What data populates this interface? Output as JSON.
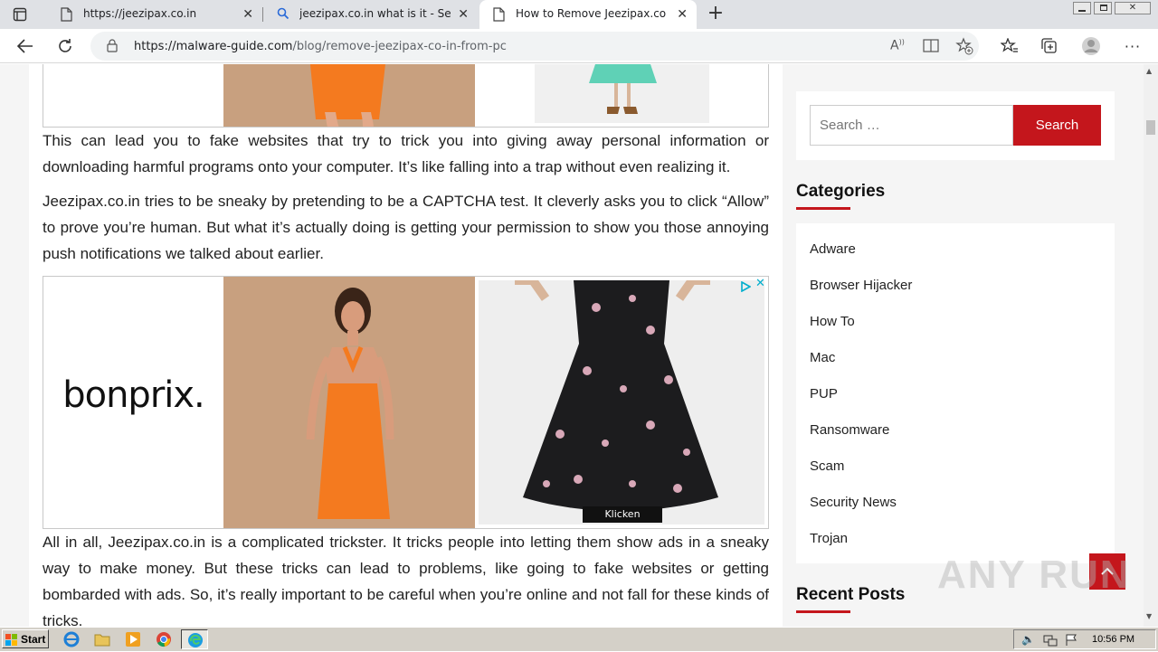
{
  "browser": {
    "tabs": [
      {
        "title": "https://jeezipax.co.in",
        "icon": "page-icon"
      },
      {
        "title": "jeezipax.co.in what is it - Search",
        "icon": "search-icon"
      },
      {
        "title": "How to Remove Jeezipax.co.in f",
        "icon": "page-icon",
        "active": true
      }
    ],
    "new_tab_label": "+",
    "url_domain": "https://malware-guide.com",
    "url_path": "/blog/remove-jeezipax-co-in-from-pc"
  },
  "article": {
    "para1": "This can lead you to fake websites that try to trick you into giving away personal information or downloading harmful programs onto your computer. It’s like falling into a trap without even realizing it.",
    "para2": "Jeezipax.co.in tries to be sneaky by pretending to be a CAPTCHA test. It cleverly asks you to click “Allow” to prove you’re human. But what it’s actually doing is getting your permission to show you those annoying push notifications we talked about earlier.",
    "para3": "All in all, Jeezipax.co.in is a complicated trickster. It tricks people into letting them show ads in a sneaky way to make money. But these tricks can lead to problems, like going to fake websites or getting bombarded with ads. So, it’s really important to be careful when you’re online and not fall for these kinds of tricks."
  },
  "ad": {
    "brand": "bonprix.",
    "cta": "Klicken",
    "choices_icon": "adchoices-icon",
    "close_icon": "close-icon"
  },
  "sidebar": {
    "search_placeholder": "Search …",
    "search_button": "Search",
    "categories_heading": "Categories",
    "categories": [
      "Adware",
      "Browser Hijacker",
      "How To",
      "Mac",
      "PUP",
      "Ransomware",
      "Scam",
      "Security News",
      "Trojan"
    ],
    "recent_heading": "Recent Posts"
  },
  "watermark": "ANY RUN",
  "taskbar": {
    "start": "Start",
    "clock": "10:56 PM"
  },
  "colors": {
    "accent": "#c4161c",
    "dress_orange": "#f47a1f",
    "ad_bg": "#c8a07f"
  }
}
